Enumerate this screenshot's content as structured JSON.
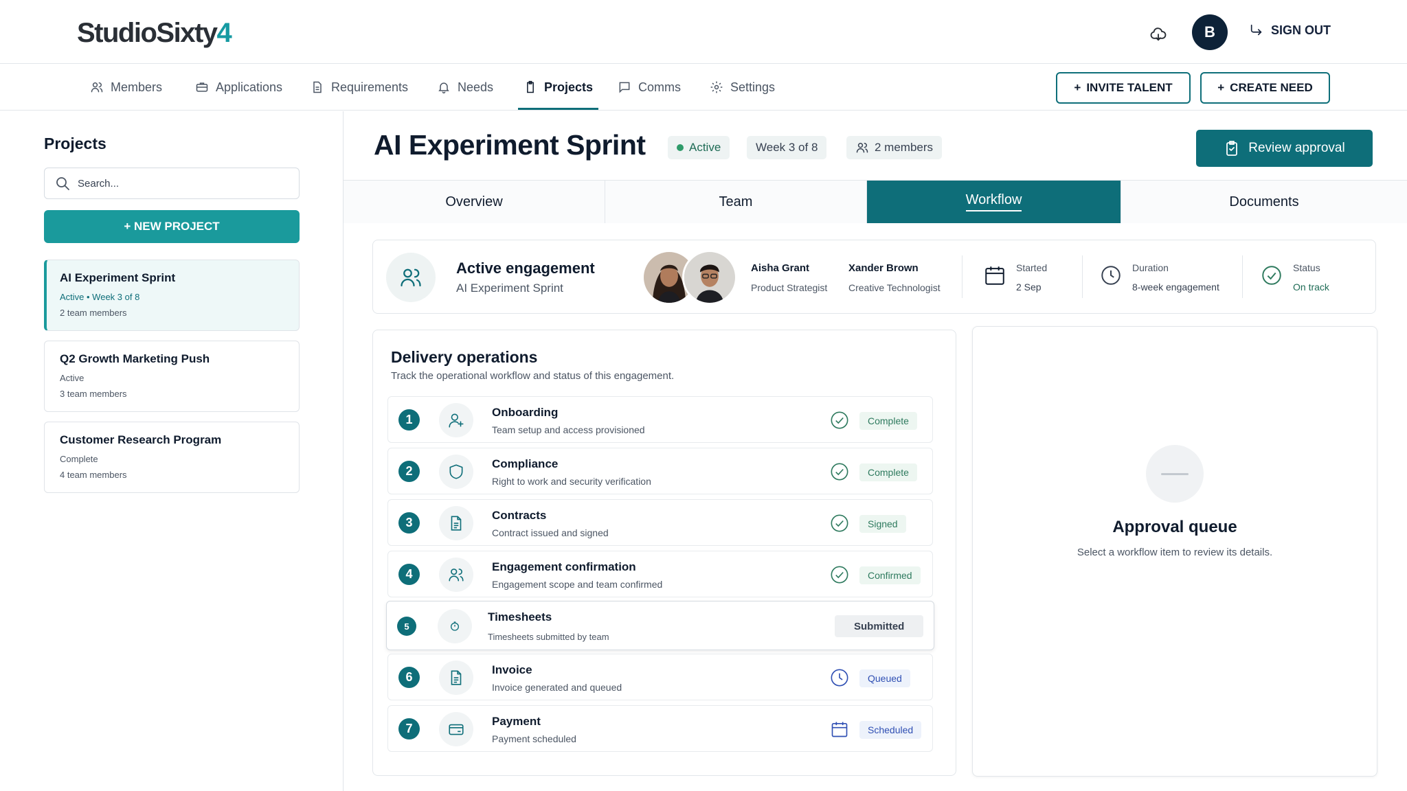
{
  "brand": {
    "logo_main": "StudioSixty",
    "logo_accent": "4"
  },
  "header": {
    "avatar_initial": "B",
    "sign_out": "SIGN OUT"
  },
  "nav": {
    "items": [
      {
        "label": "Members",
        "icon": "members-icon"
      },
      {
        "label": "Applications",
        "icon": "briefcase-icon"
      },
      {
        "label": "Requirements",
        "icon": "document-icon"
      },
      {
        "label": "Needs",
        "icon": "bell-icon"
      },
      {
        "label": "Projects",
        "icon": "clipboard-icon",
        "active": true
      },
      {
        "label": "Comms",
        "icon": "chat-icon"
      },
      {
        "label": "Settings",
        "icon": "gear-icon"
      }
    ],
    "invite_talent": "INVITE TALENT",
    "create_need": "CREATE NEED"
  },
  "sidebar": {
    "title": "Projects",
    "search_placeholder": "Search...",
    "new_project": "+ NEW PROJECT",
    "projects": [
      {
        "name": "AI Experiment Sprint",
        "status": "Active • Week 3 of 8",
        "members": "2 team members",
        "selected": true
      },
      {
        "name": "Q2 Growth Marketing Push",
        "status": "Active",
        "members": "3 team members"
      },
      {
        "name": "Customer Research Program",
        "status": "Complete",
        "members": "4 team members"
      }
    ]
  },
  "project": {
    "title": "AI Experiment Sprint",
    "status_chip": "Active",
    "week_chip": "Week 3 of 8",
    "members_chip": "2 members",
    "review_button": "Review approval",
    "tabs": [
      "Overview",
      "Team",
      "Workflow",
      "Documents"
    ],
    "active_tab": "Workflow"
  },
  "engagement": {
    "title": "Active engagement",
    "subtitle": "AI Experiment Sprint",
    "people": [
      {
        "name": "Aisha Grant",
        "role": "Product Strategist"
      },
      {
        "name": "Xander Brown",
        "role": "Creative Technologist"
      }
    ],
    "started_label": "Started",
    "started_value": "2 Sep",
    "duration_label": "Duration",
    "duration_value": "8-week engagement",
    "status_label": "Status",
    "status_value": "On track"
  },
  "delivery": {
    "title": "Delivery operations",
    "subtitle": "Track the operational workflow and status of this engagement.",
    "steps": [
      {
        "num": "1",
        "name": "Onboarding",
        "desc": "Team setup and access provisioned",
        "badge": "Complete",
        "icon": "user-plus-icon",
        "state": "done"
      },
      {
        "num": "2",
        "name": "Compliance",
        "desc": "Right to work and security verification",
        "badge": "Complete",
        "icon": "shield-icon",
        "state": "done"
      },
      {
        "num": "3",
        "name": "Contracts",
        "desc": "Contract issued and signed",
        "badge": "Signed",
        "icon": "document-icon",
        "state": "done"
      },
      {
        "num": "4",
        "name": "Engagement confirmation",
        "desc": "Engagement scope and team confirmed",
        "badge": "Confirmed",
        "icon": "team-icon",
        "state": "done"
      },
      {
        "num": "5",
        "name": "Timesheets",
        "desc": "Timesheets submitted by team",
        "badge": "Submitted",
        "icon": "timer-icon",
        "state": "current"
      },
      {
        "num": "6",
        "name": "Invoice",
        "desc": "Invoice generated and queued",
        "badge": "Queued",
        "icon": "invoice-icon",
        "state": "queued"
      },
      {
        "num": "7",
        "name": "Payment",
        "desc": "Payment scheduled",
        "badge": "Scheduled",
        "icon": "card-icon",
        "state": "scheduled"
      }
    ]
  },
  "queue": {
    "title": "Approval queue",
    "subtitle": "Select a workflow item to review its details."
  },
  "colors": {
    "accent": "#0e6e79",
    "teal": "#1a9a9c",
    "navy": "#0f1b2d",
    "success": "#2e7a5e",
    "info": "#2f4fb3"
  }
}
